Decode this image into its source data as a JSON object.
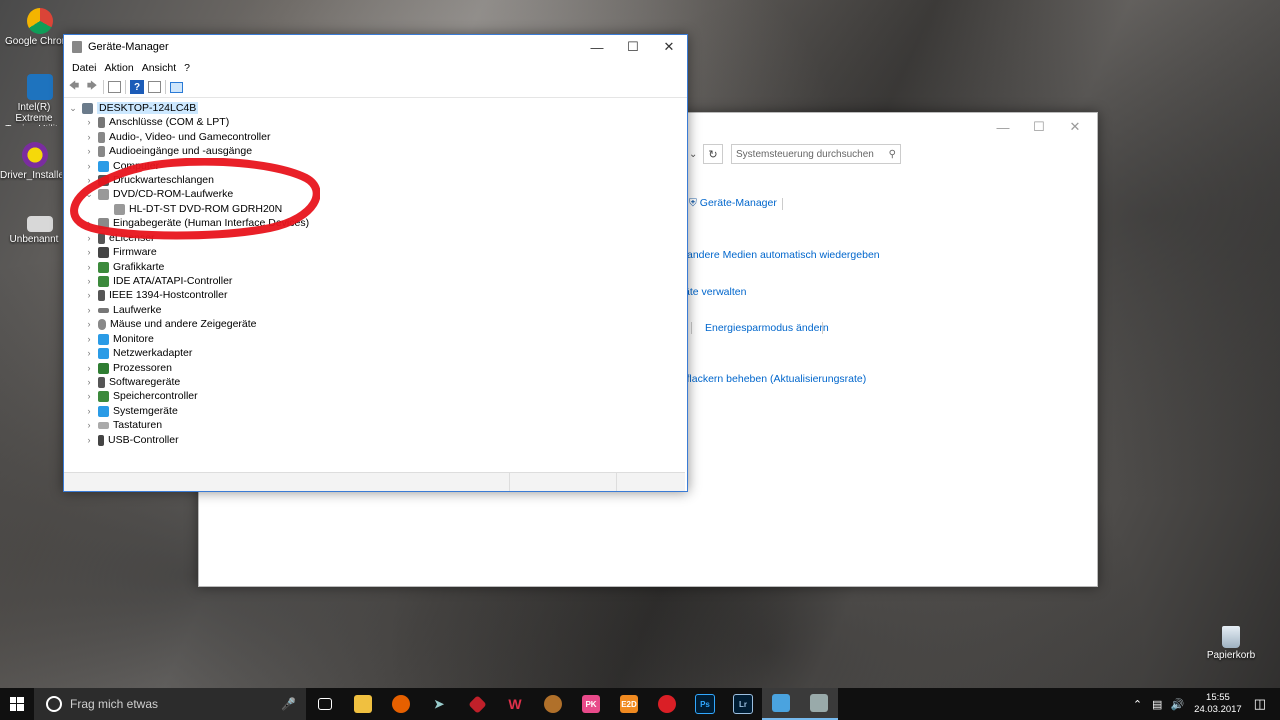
{
  "desktop": {
    "icons": [
      {
        "label": "Google Chrome",
        "icon": "chrome-icon"
      },
      {
        "label": "Intel(R) Extreme Tuning Utility",
        "icon": "intel-xtu-icon"
      },
      {
        "label": "Driver_Installer",
        "icon": "driver-installer-icon"
      },
      {
        "label": "Unbenannt",
        "icon": "unbenannt-icon"
      },
      {
        "label": "Papierkorb",
        "icon": "recycle-bin-icon"
      }
    ]
  },
  "control_panel": {
    "search_placeholder": "Systemsteuerung durchsuchen",
    "links": [
      "Geräte-Manager",
      "andere Medien automatisch wiedergeben",
      "äte verwalten",
      "Energiesparmodus ändern",
      "rflackern beheben (Aktualisierungsrate)"
    ]
  },
  "device_manager": {
    "title": "Geräte-Manager",
    "menu": [
      "Datei",
      "Aktion",
      "Ansicht",
      "?"
    ],
    "root": "DESKTOP-124LC4B",
    "categories": [
      "Anschlüsse (COM & LPT)",
      "Audio-, Video- und Gamecontroller",
      "Audioeingänge und -ausgänge",
      "Computer",
      "Druckwarteschlangen",
      "DVD/CD-ROM-Laufwerke",
      "HL-DT-ST DVD-ROM GDRH20N",
      "Eingabegeräte (Human Interface Devices)",
      "eLicenser",
      "Firmware",
      "Grafikkarte",
      "IDE ATA/ATAPI-Controller",
      "IEEE 1394-Hostcontroller",
      "Laufwerke",
      "Mäuse und andere Zeigegeräte",
      "Monitore",
      "Netzwerkadapter",
      "Prozessoren",
      "Softwaregeräte",
      "Speichercontroller",
      "Systemgeräte",
      "Tastaturen",
      "USB-Controller"
    ]
  },
  "taskbar": {
    "search_placeholder": "Frag mich etwas",
    "apps": [
      "task-view-icon",
      "file-explorer-icon",
      "firefox-icon",
      "app-plane-icon",
      "app-red-icon",
      "app-w-icon",
      "app-round-icon",
      "app-pk-icon",
      "app-e2d-icon",
      "creative-cloud-icon",
      "photoshop-icon",
      "lightroom-icon",
      "control-panel-icon",
      "device-manager-icon"
    ],
    "time": "15:55",
    "date": "24.03.2017"
  },
  "colors": {
    "accent": "#0066cc",
    "annotation": "#e8141c",
    "taskbar": "#101010"
  }
}
